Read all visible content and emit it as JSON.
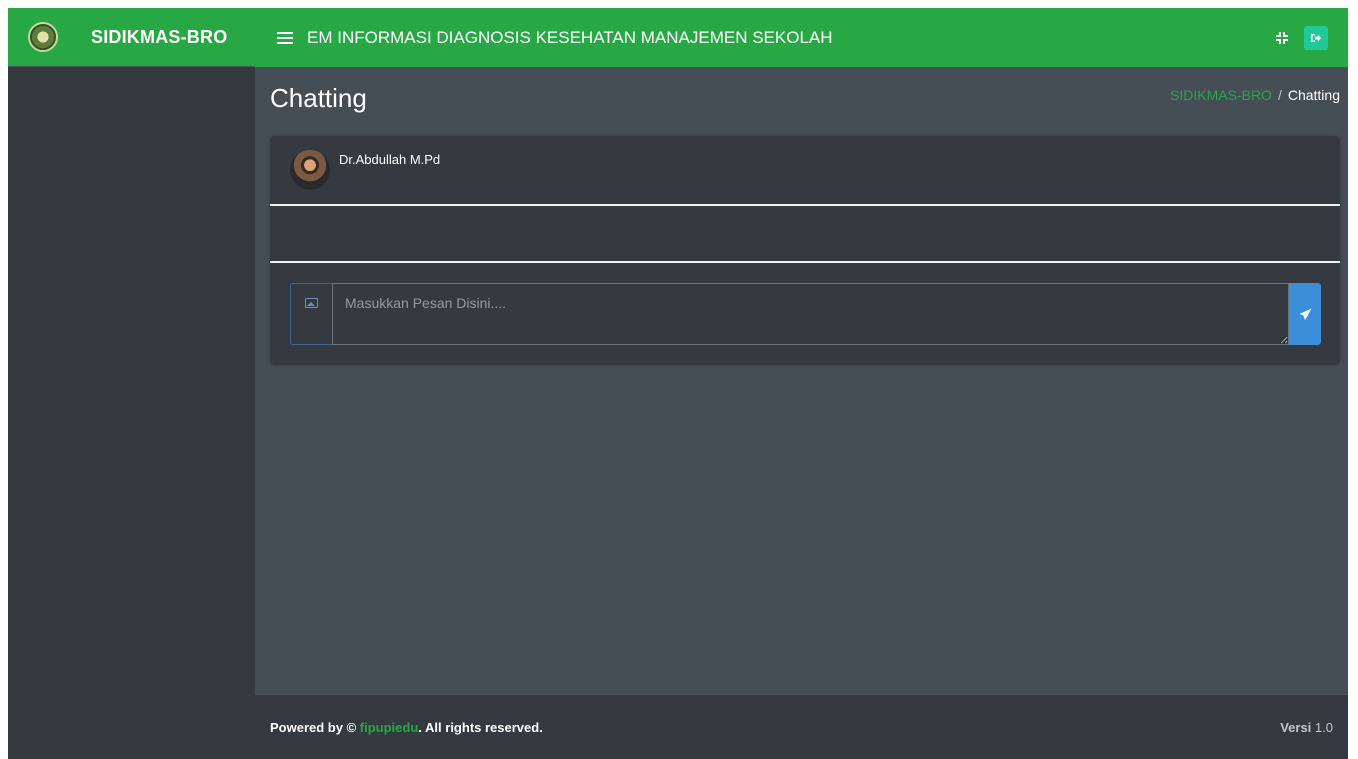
{
  "sidebar": {
    "brand": "SIDIKMAS-BRO"
  },
  "topbar": {
    "title": "EM INFORMASI DIAGNOSIS KESEHATAN MANAJEMEN SEKOLAH"
  },
  "header": {
    "title": "Chatting",
    "breadcrumb": {
      "home": "SIDIKMAS-BRO",
      "separator": "/",
      "current": "Chatting"
    }
  },
  "chat": {
    "contact_name": "Dr.Abdullah M.Pd",
    "input_placeholder": "Masukkan Pesan Disini....",
    "input_value": ""
  },
  "footer": {
    "powered_by": "Powered by ©",
    "brand": "fipupiedu",
    "rights": ". All rights reserved.",
    "version_label": "Versi",
    "version_number": "1.0"
  },
  "icons": {
    "menu": "hamburger-icon",
    "fullscreen": "compress-icon",
    "logout": "sign-out-icon",
    "image": "image-icon",
    "send": "paper-plane-icon"
  },
  "colors": {
    "accent": "#28a745",
    "background": "#454d55",
    "panel": "#343a40",
    "send": "#3b8fd9",
    "logout": "#20c997"
  }
}
